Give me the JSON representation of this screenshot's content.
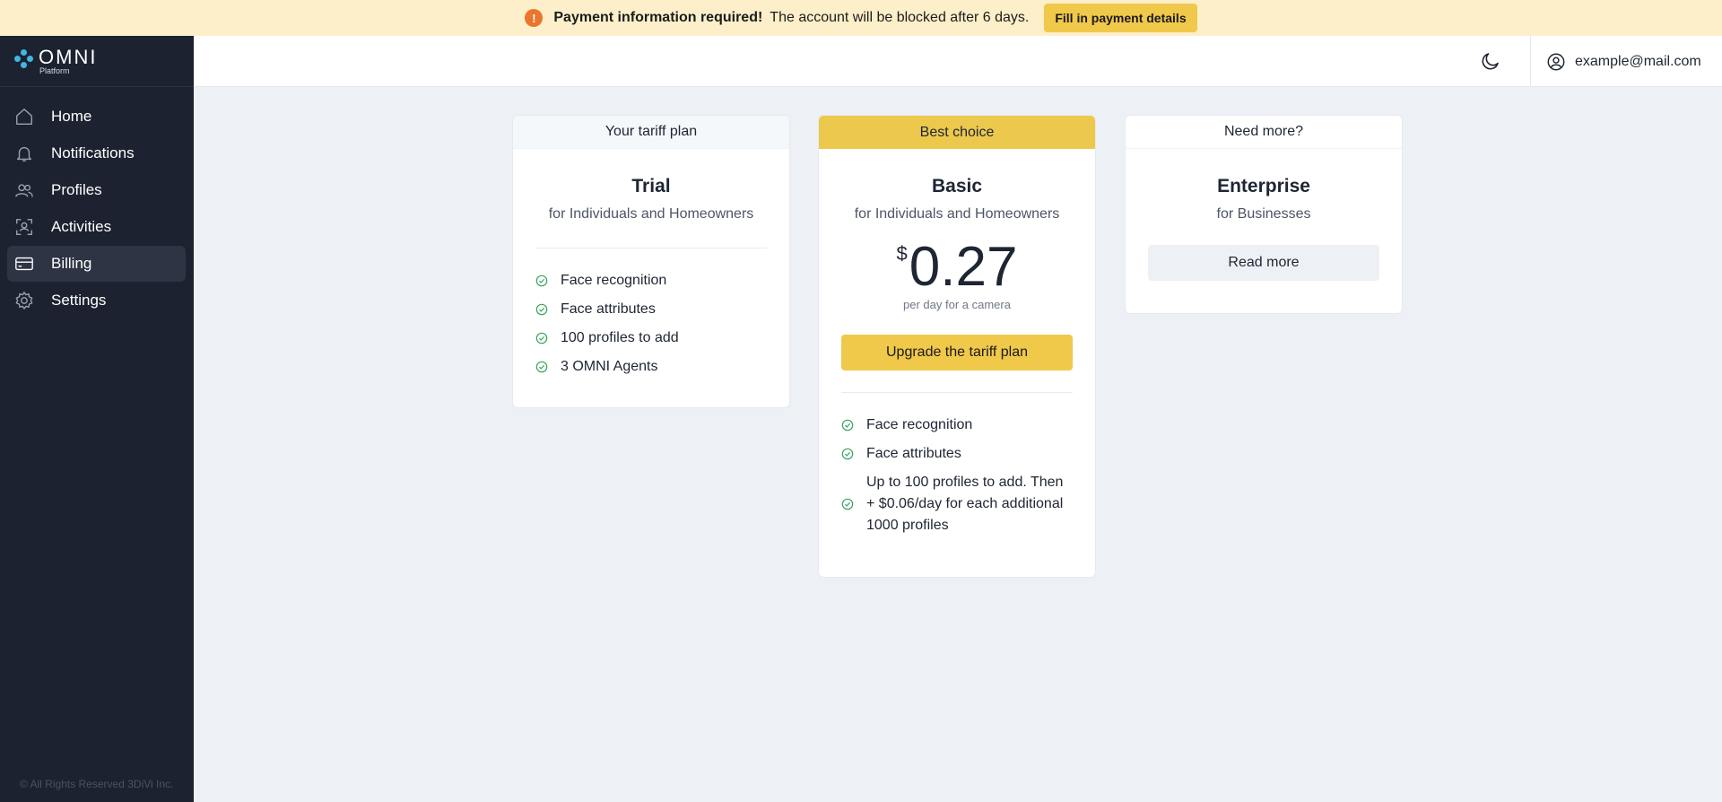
{
  "banner": {
    "title": "Payment information required!",
    "message": "The account will be blocked after 6 days.",
    "button": "Fill in payment details",
    "icon": "warning-icon",
    "icon_glyph": "!",
    "accent": "#e9762b"
  },
  "logo": {
    "name": "OMNI",
    "sub": "Platform"
  },
  "sidebar": {
    "items": [
      {
        "label": "Home",
        "icon": "home-icon"
      },
      {
        "label": "Notifications",
        "icon": "bell-icon"
      },
      {
        "label": "Profiles",
        "icon": "users-icon"
      },
      {
        "label": "Activities",
        "icon": "activity-icon"
      },
      {
        "label": "Billing",
        "icon": "billing-card-icon",
        "active": true
      },
      {
        "label": "Settings",
        "icon": "gear-icon"
      }
    ],
    "copyright": "© All Rights Reserved 3DiVi Inc."
  },
  "topbar": {
    "theme_icon": "moon-icon",
    "user_email": "example@mail.com",
    "user_icon": "user-circle-icon"
  },
  "plans": [
    {
      "header": "Your tariff plan",
      "name": "Trial",
      "for": "for Individuals and Homeowners",
      "features": [
        "Face recognition",
        "Face attributes",
        "100 profiles to add",
        "3 OMNI Agents"
      ]
    },
    {
      "header": "Best choice",
      "name": "Basic",
      "for": "for Individuals and Homeowners",
      "currency": "$",
      "price": "0.27",
      "per": "per day for a camera",
      "button": "Upgrade the tariff plan",
      "features": [
        "Face recognition",
        "Face attributes",
        "Up to 100 profiles to add. Then + $0.06/day for each additional 1000 profiles"
      ]
    },
    {
      "header": "Need more?",
      "name": "Enterprise",
      "for": "for Businesses",
      "button": "Read more"
    }
  ],
  "colors": {
    "accent_yellow": "#f0c84a",
    "banner_bg": "#fdefc9",
    "sidebar_bg": "#1c2230",
    "check_green": "#3aa55d"
  }
}
